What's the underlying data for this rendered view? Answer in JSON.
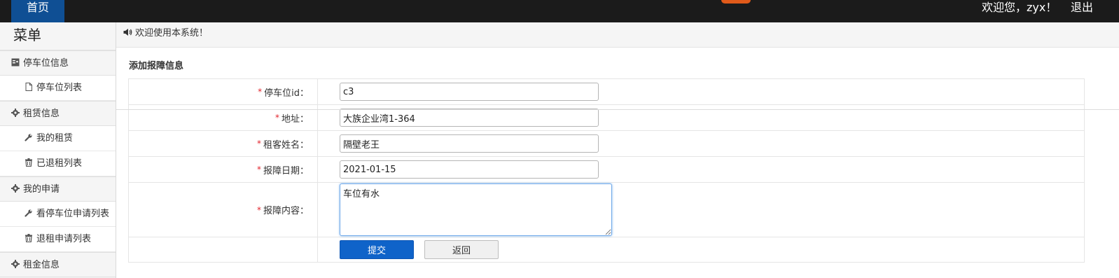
{
  "topbar": {
    "home": "首页",
    "welcome": "欢迎您，zyx！",
    "logout": "退出",
    "logo_color": "#e05a1a"
  },
  "sidebar": {
    "title": "菜单",
    "groups": [
      {
        "label": "停车位信息",
        "icon": "id-card-icon",
        "items": [
          {
            "label": "停车位列表",
            "icon": "file-icon"
          }
        ]
      },
      {
        "label": "租赁信息",
        "icon": "gear-icon",
        "items": [
          {
            "label": "我的租赁",
            "icon": "wrench-icon"
          },
          {
            "label": "已退租列表",
            "icon": "trash-icon"
          }
        ]
      },
      {
        "label": "我的申请",
        "icon": "gear-icon",
        "items": [
          {
            "label": "看停车位申请列表",
            "icon": "wrench-icon"
          },
          {
            "label": "退租申请列表",
            "icon": "trash-icon"
          }
        ]
      },
      {
        "label": "租金信息",
        "icon": "gear-icon",
        "items": []
      }
    ]
  },
  "notice": {
    "text": "欢迎使用本系统！",
    "icon": "speaker-icon"
  },
  "form": {
    "title": "添加报障信息",
    "fields": [
      {
        "label": "停车位id：",
        "value": "c3"
      },
      {
        "label": "地址：",
        "value": "大族企业湾1-364"
      },
      {
        "label": "租客姓名：",
        "value": "隔壁老王"
      },
      {
        "label": "报障日期：",
        "value": "2021-01-15"
      },
      {
        "label": "报障内容：",
        "value": "车位有水"
      }
    ],
    "required_mark": "*",
    "submit": "提交",
    "back": "返回"
  },
  "colors": {
    "accent": "#0f63c9",
    "topbar": "#1b1b1b",
    "home_tab": "#0f4f94",
    "required": "#e2242c"
  }
}
